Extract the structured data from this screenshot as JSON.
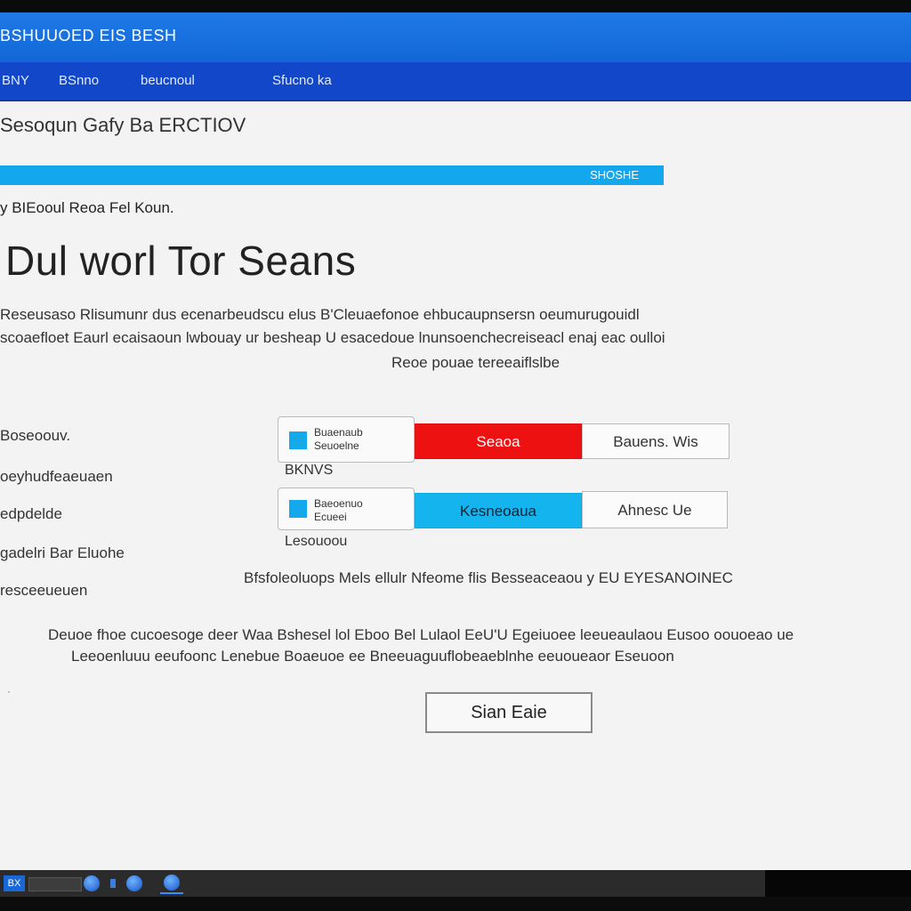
{
  "window": {
    "title": "BSHUUOED EIS BESH"
  },
  "menu": {
    "items": [
      "BNY",
      "BSnno",
      "beucnoul",
      "Sfucno ka"
    ]
  },
  "page": {
    "heading": "Sesoqun Gafy Ba ERCTIOV",
    "progress": {
      "text": "SHOSHE",
      "percent": 100
    },
    "section_label": "y BIEooul Reoa Fel Koun.",
    "title": "Dul worl Tor Seans",
    "intro_lines": [
      "Reseusaso Rlisumunr dus ecenarbeudscu elus B'Cleuaefonoe ehbucaupnsersn oeumurugouidl",
      "scoaefloet Eaurl ecaisaoun lwbouay ur besheap U esacedoue lnunsoenchecreiseacl enaj eac oulloi",
      "Reoe pouae tereeaiflslbe"
    ],
    "form_labels": [
      "Boseoouv.",
      "oeyhudfeaeuaen",
      "edpdelde",
      "gadelri Bar Eluohe",
      "resceeueuen"
    ],
    "options": [
      {
        "line1": "Buaenaub",
        "line2": "Seuoelne"
      },
      {
        "line1": "Baeoenuo",
        "line2": "Ecueei"
      }
    ],
    "option_captions": [
      "BKNVS",
      "Lesouoou"
    ],
    "rows": [
      {
        "highlight": "Seaoa",
        "value": "Bauens. Wis"
      },
      {
        "highlight": "Kesneoaua",
        "value": "Ahnesc Ue"
      }
    ],
    "note": "Bfsfoleoluops Mels ellulr Nfeome flis Besseaceaou y EU EYESANOINEC",
    "footer_lines": [
      "Deuoe fhoe cucoesoge deer Waa Bshesel lol Eboo Bel Lulaol EeU'U Egeiuoee leeueaulaou Eusoo oouoeao ue",
      "Leeoenluuu eeufoonc Lenebue Boaeuoe ee Bneeuaguuflobeaeblnhe eeuoueaor Eseuoon"
    ],
    "submit_label": "Sian Eaie"
  },
  "taskbar": {
    "start_label": "BX"
  }
}
